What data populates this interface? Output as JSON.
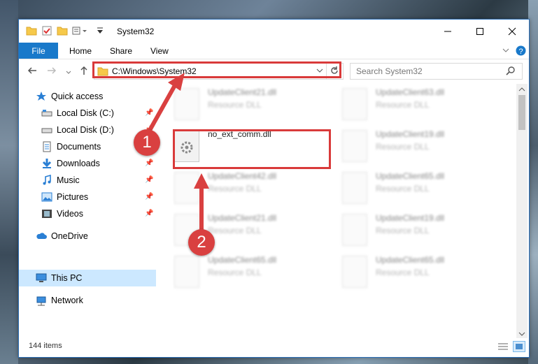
{
  "window": {
    "title": "System32"
  },
  "ribbon": {
    "tabs": [
      "File",
      "Home",
      "Share",
      "View"
    ]
  },
  "address": {
    "path": "C:\\Windows\\System32"
  },
  "search": {
    "placeholder": "Search System32"
  },
  "sidebar": {
    "items": [
      {
        "label": "Quick access",
        "icon": "star-icon",
        "pinned": false
      },
      {
        "label": "Local Disk (C:)",
        "icon": "drive-icon",
        "pinned": true
      },
      {
        "label": "Local Disk (D:)",
        "icon": "drive-icon",
        "pinned": true
      },
      {
        "label": "Documents",
        "icon": "documents-icon",
        "pinned": true
      },
      {
        "label": "Downloads",
        "icon": "download-icon",
        "pinned": true
      },
      {
        "label": "Music",
        "icon": "music-icon",
        "pinned": true
      },
      {
        "label": "Pictures",
        "icon": "pictures-icon",
        "pinned": true
      },
      {
        "label": "Videos",
        "icon": "videos-icon",
        "pinned": true
      },
      {
        "label": "OneDrive",
        "icon": "cloud-icon",
        "pinned": false
      },
      {
        "label": "This PC",
        "icon": "computer-icon",
        "pinned": false,
        "selected": true
      },
      {
        "label": "Network",
        "icon": "network-icon",
        "pinned": false
      }
    ]
  },
  "files": {
    "highlighted": {
      "name": "no_ext_comm.dll"
    },
    "left_column": [
      {
        "name": "UpdateClient21.dll",
        "type": "Resource DLL"
      },
      {
        "name": "UpdateClient42.dll",
        "type": "Resource DLL"
      },
      {
        "name": "UpdateClient21.dll",
        "type": "Resource DLL"
      },
      {
        "name": "UpdateClient65.dll",
        "type": "Resource DLL"
      }
    ],
    "right_column": [
      {
        "name": "UpdateClient63.dll",
        "type": "Resource DLL"
      },
      {
        "name": "UpdateClient19.dll",
        "type": "Resource DLL"
      },
      {
        "name": "UpdateClient65.dll",
        "type": "Resource DLL"
      },
      {
        "name": "UpdateClient19.dll",
        "type": "Resource DLL"
      },
      {
        "name": "UpdateClient65.dll",
        "type": "Resource DLL"
      }
    ]
  },
  "status": {
    "count": "144 items"
  },
  "callouts": [
    "1",
    "2"
  ],
  "colors": {
    "accent": "#1979ca",
    "highlight": "#d93a3a",
    "selected_bg": "#cce8ff"
  }
}
